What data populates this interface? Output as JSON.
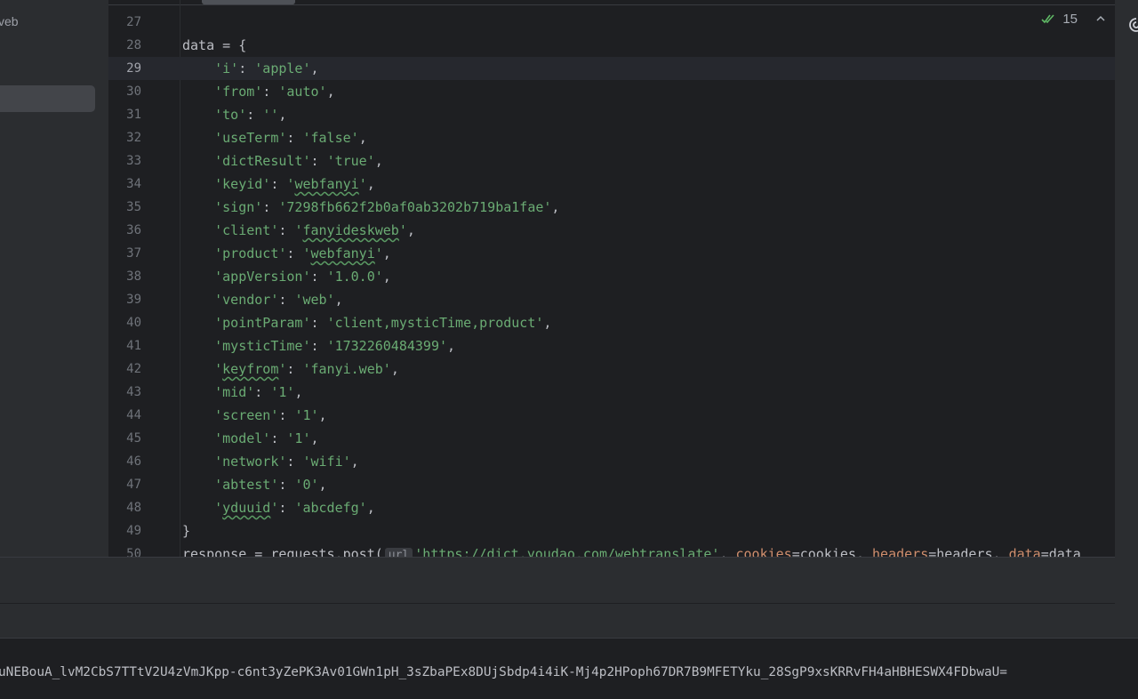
{
  "project": {
    "label": "veb"
  },
  "inspection": {
    "count": "15",
    "check_icon": "check-double-icon",
    "prev_icon": "chevron-up-icon",
    "next_icon": "chevron-down-icon"
  },
  "editor": {
    "lines": [
      {
        "n": "27",
        "tokens": []
      },
      {
        "n": "28",
        "tokens": [
          [
            "t",
            "data = {"
          ]
        ]
      },
      {
        "n": "29",
        "current": true,
        "tokens": [
          [
            "t",
            "    "
          ],
          [
            "s",
            "'i'"
          ],
          [
            "t",
            ": "
          ],
          [
            "s",
            "'apple'"
          ],
          [
            "t",
            ","
          ]
        ]
      },
      {
        "n": "30",
        "tokens": [
          [
            "t",
            "    "
          ],
          [
            "s",
            "'from'"
          ],
          [
            "t",
            ": "
          ],
          [
            "s",
            "'auto'"
          ],
          [
            "t",
            ","
          ]
        ]
      },
      {
        "n": "31",
        "tokens": [
          [
            "t",
            "    "
          ],
          [
            "s",
            "'to'"
          ],
          [
            "t",
            ": "
          ],
          [
            "s",
            "''"
          ],
          [
            "t",
            ","
          ]
        ]
      },
      {
        "n": "32",
        "tokens": [
          [
            "t",
            "    "
          ],
          [
            "s",
            "'useTerm'"
          ],
          [
            "t",
            ": "
          ],
          [
            "s",
            "'false'"
          ],
          [
            "t",
            ","
          ]
        ]
      },
      {
        "n": "33",
        "tokens": [
          [
            "t",
            "    "
          ],
          [
            "s",
            "'dictResult'"
          ],
          [
            "t",
            ": "
          ],
          [
            "s",
            "'true'"
          ],
          [
            "t",
            ","
          ]
        ]
      },
      {
        "n": "34",
        "tokens": [
          [
            "t",
            "    "
          ],
          [
            "s",
            "'keyid'"
          ],
          [
            "t",
            ": "
          ],
          [
            "s",
            "'"
          ],
          [
            "sq",
            "webfanyi"
          ],
          [
            "s",
            "'"
          ],
          [
            "t",
            ","
          ]
        ]
      },
      {
        "n": "35",
        "tokens": [
          [
            "t",
            "    "
          ],
          [
            "s",
            "'sign'"
          ],
          [
            "t",
            ": "
          ],
          [
            "s",
            "'7298fb662f2b0af0ab3202b719ba1fae'"
          ],
          [
            "t",
            ","
          ]
        ]
      },
      {
        "n": "36",
        "tokens": [
          [
            "t",
            "    "
          ],
          [
            "s",
            "'client'"
          ],
          [
            "t",
            ": "
          ],
          [
            "s",
            "'"
          ],
          [
            "sq",
            "fanyideskweb"
          ],
          [
            "s",
            "'"
          ],
          [
            "t",
            ","
          ]
        ]
      },
      {
        "n": "37",
        "tokens": [
          [
            "t",
            "    "
          ],
          [
            "s",
            "'product'"
          ],
          [
            "t",
            ": "
          ],
          [
            "s",
            "'"
          ],
          [
            "sq",
            "webfanyi"
          ],
          [
            "s",
            "'"
          ],
          [
            "t",
            ","
          ]
        ]
      },
      {
        "n": "38",
        "tokens": [
          [
            "t",
            "    "
          ],
          [
            "s",
            "'appVersion'"
          ],
          [
            "t",
            ": "
          ],
          [
            "s",
            "'1.0.0'"
          ],
          [
            "t",
            ","
          ]
        ]
      },
      {
        "n": "39",
        "tokens": [
          [
            "t",
            "    "
          ],
          [
            "s",
            "'vendor'"
          ],
          [
            "t",
            ": "
          ],
          [
            "s",
            "'web'"
          ],
          [
            "t",
            ","
          ]
        ]
      },
      {
        "n": "40",
        "tokens": [
          [
            "t",
            "    "
          ],
          [
            "s",
            "'pointParam'"
          ],
          [
            "t",
            ": "
          ],
          [
            "s",
            "'client,mysticTime,product'"
          ],
          [
            "t",
            ","
          ]
        ]
      },
      {
        "n": "41",
        "tokens": [
          [
            "t",
            "    "
          ],
          [
            "s",
            "'mysticTime'"
          ],
          [
            "t",
            ": "
          ],
          [
            "s",
            "'1732260484399'"
          ],
          [
            "t",
            ","
          ]
        ]
      },
      {
        "n": "42",
        "tokens": [
          [
            "t",
            "    "
          ],
          [
            "s",
            "'"
          ],
          [
            "sq",
            "keyfrom"
          ],
          [
            "s",
            "'"
          ],
          [
            "t",
            ": "
          ],
          [
            "s",
            "'fanyi.web'"
          ],
          [
            "t",
            ","
          ]
        ]
      },
      {
        "n": "43",
        "tokens": [
          [
            "t",
            "    "
          ],
          [
            "s",
            "'mid'"
          ],
          [
            "t",
            ": "
          ],
          [
            "s",
            "'1'"
          ],
          [
            "t",
            ","
          ]
        ]
      },
      {
        "n": "44",
        "tokens": [
          [
            "t",
            "    "
          ],
          [
            "s",
            "'screen'"
          ],
          [
            "t",
            ": "
          ],
          [
            "s",
            "'1'"
          ],
          [
            "t",
            ","
          ]
        ]
      },
      {
        "n": "45",
        "tokens": [
          [
            "t",
            "    "
          ],
          [
            "s",
            "'model'"
          ],
          [
            "t",
            ": "
          ],
          [
            "s",
            "'1'"
          ],
          [
            "t",
            ","
          ]
        ]
      },
      {
        "n": "46",
        "tokens": [
          [
            "t",
            "    "
          ],
          [
            "s",
            "'network'"
          ],
          [
            "t",
            ": "
          ],
          [
            "s",
            "'wifi'"
          ],
          [
            "t",
            ","
          ]
        ]
      },
      {
        "n": "47",
        "tokens": [
          [
            "t",
            "    "
          ],
          [
            "s",
            "'abtest'"
          ],
          [
            "t",
            ": "
          ],
          [
            "s",
            "'0'"
          ],
          [
            "t",
            ","
          ]
        ]
      },
      {
        "n": "48",
        "tokens": [
          [
            "t",
            "    "
          ],
          [
            "s",
            "'"
          ],
          [
            "sq",
            "yduuid"
          ],
          [
            "s",
            "'"
          ],
          [
            "t",
            ": "
          ],
          [
            "s",
            "'abcdefg'"
          ],
          [
            "t",
            ","
          ]
        ]
      },
      {
        "n": "49",
        "tokens": [
          [
            "t",
            "}"
          ]
        ]
      },
      {
        "n": "50",
        "tokens": [
          [
            "t",
            "response = requests.post("
          ],
          [
            "h",
            "url"
          ],
          [
            "s",
            "'https://dict.youdao.com/webtranslate'"
          ],
          [
            "t",
            ", "
          ],
          [
            "p",
            "cookies"
          ],
          [
            "t",
            "=cookies, "
          ],
          [
            "p",
            "headers"
          ],
          [
            "t",
            "=headers, "
          ],
          [
            "p",
            "data"
          ],
          [
            "t",
            "=data"
          ]
        ]
      }
    ]
  },
  "console": {
    "output": "uNEBouA_lvM2CbS7TTtV2U4zVmJKpp-c6nt3yZePK3Av01GWn1pH_3sZbaPEx8DUjSbdp4i4iK-Mj4p2HPoph67DR7B9MFETYku_28SgP9xsKRRvFH4aHBHESWX4FDbwaU="
  },
  "icons": {
    "ai_assistant": "ai-assistant-icon"
  }
}
